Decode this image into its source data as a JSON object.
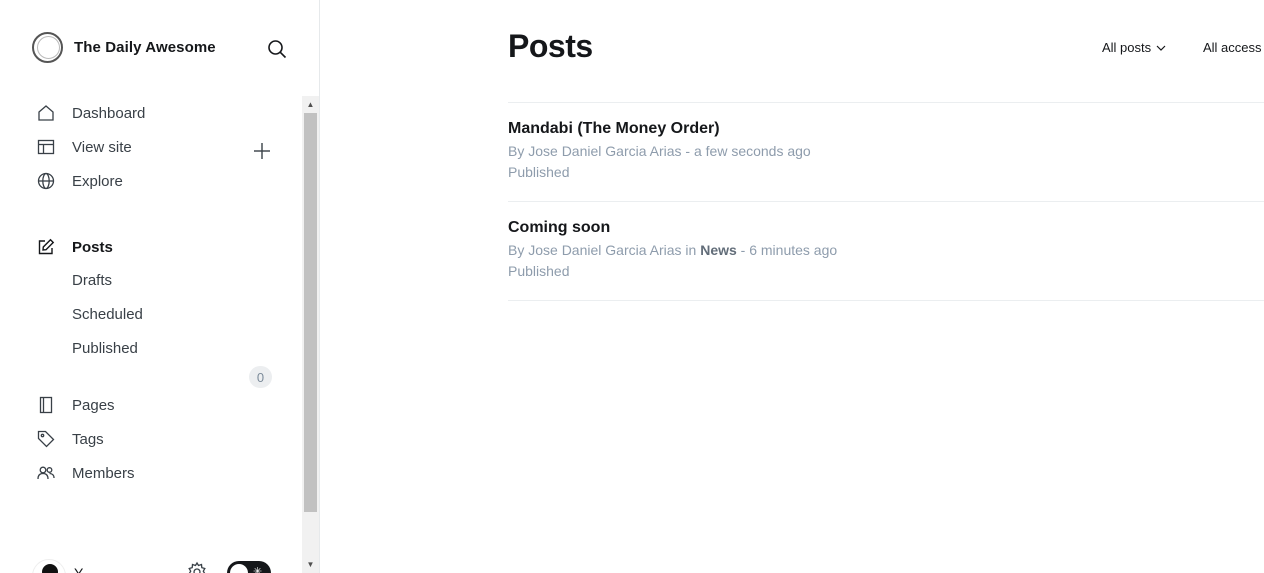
{
  "sidebar": {
    "brand_title": "The Daily Awesome",
    "nav": {
      "dashboard": "Dashboard",
      "view_site": "View site",
      "explore": "Explore",
      "posts": "Posts",
      "drafts": "Drafts",
      "scheduled": "Scheduled",
      "published": "Published",
      "pages": "Pages",
      "tags": "Tags",
      "members": "Members",
      "members_count": "0"
    },
    "footer": {
      "user_initial": "Y"
    }
  },
  "main": {
    "title": "Posts",
    "filters": {
      "type": "All posts",
      "access": "All access"
    },
    "posts": [
      {
        "title": "Mandabi (The Money Order)",
        "byline": "By Jose Daniel Garcia Arias",
        "tag": "",
        "time": " - a few seconds ago",
        "status": "Published"
      },
      {
        "title": "Coming soon",
        "byline": "By Jose Daniel Garcia Arias in ",
        "tag": "News",
        "time": " - 6 minutes ago",
        "status": "Published"
      }
    ]
  },
  "icons": {
    "search": "search-icon",
    "home": "home-icon",
    "view_site": "layout-icon",
    "explore": "globe-icon",
    "posts": "pen-square-icon",
    "add": "plus-icon",
    "pages": "pages-icon",
    "tags": "tag-icon",
    "members": "members-icon",
    "settings": "gear-icon"
  },
  "colors": {
    "text_primary": "#15171a",
    "text_muted": "#8e9cac",
    "border": "#ebeef0"
  }
}
